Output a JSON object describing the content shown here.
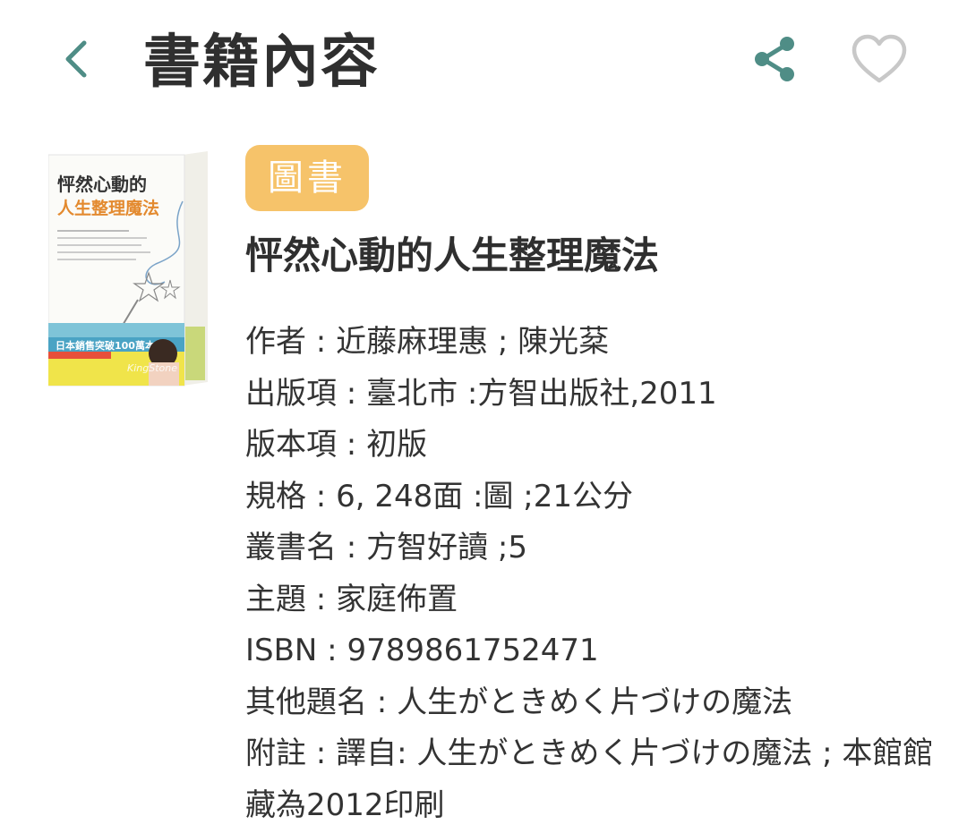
{
  "header": {
    "title": "書籍內容",
    "icons": {
      "back": "chevron-left-icon",
      "share": "share-icon",
      "favorite": "heart-icon"
    },
    "accent_color": "#4f8d86"
  },
  "book": {
    "type_badge": "圖書",
    "badge_color": "#f6c36a",
    "title": "怦然心動的人生整理魔法",
    "cover": {
      "title_line1": "怦然心動的",
      "title_line2": "人生整理魔法",
      "banner": "日本銷售突破100萬本！",
      "watermark": "KingStone"
    },
    "metadata": [
      {
        "label": "作者",
        "value": "近藤麻理惠 ; 陳光棻"
      },
      {
        "label": "出版項",
        "value": "臺北市 :方智出版社,2011"
      },
      {
        "label": "版本項",
        "value": "初版"
      },
      {
        "label": "規格",
        "value": "6, 248面 :圖 ;21公分"
      },
      {
        "label": "叢書名",
        "value": "方智好讀 ;5"
      },
      {
        "label": "主題",
        "value": "家庭佈置"
      },
      {
        "label": "ISBN",
        "value": "9789861752471"
      },
      {
        "label": "其他題名",
        "value": "人生がときめく片づけの魔法"
      },
      {
        "label": "附註",
        "value": "譯自: 人生がときめく片づけの魔法 ; 本館館藏為2012印刷"
      }
    ]
  }
}
